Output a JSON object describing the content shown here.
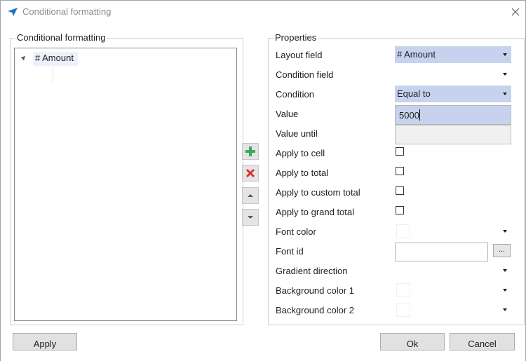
{
  "window": {
    "title": "Conditional formatting",
    "accent_color": "#1a73c8"
  },
  "left_panel": {
    "legend": "Conditional formatting",
    "tree_items": [
      {
        "label": "# Amount",
        "selected": true
      }
    ]
  },
  "side_buttons": {
    "add_icon": "plus-icon",
    "delete_icon": "delete-x-icon",
    "up_icon": "move-up-icon",
    "down_icon": "move-down-icon",
    "add_color": "#3bab5a",
    "delete_color": "#d9342b"
  },
  "properties": {
    "legend": "Properties",
    "layout_field": {
      "label": "Layout field",
      "value": "# Amount"
    },
    "condition_field": {
      "label": "Condition field",
      "value": ""
    },
    "condition": {
      "label": "Condition",
      "value": "Equal to"
    },
    "value": {
      "label": "Value",
      "value": "5000"
    },
    "value_until": {
      "label": "Value until",
      "value": ""
    },
    "apply_to_cell": {
      "label": "Apply to cell",
      "checked": false
    },
    "apply_to_total": {
      "label": "Apply to total",
      "checked": false
    },
    "apply_to_custom_total": {
      "label": "Apply to custom total",
      "checked": false
    },
    "apply_to_grand_total": {
      "label": "Apply to grand total",
      "checked": false
    },
    "font_color": {
      "label": "Font color",
      "value": ""
    },
    "font_id": {
      "label": "Font id",
      "value": "",
      "browse_label": "..."
    },
    "gradient_direction": {
      "label": "Gradient direction",
      "value": ""
    },
    "background_color_1": {
      "label": "Background color 1",
      "value": ""
    },
    "background_color_2": {
      "label": "Background color 2",
      "value": ""
    }
  },
  "footer": {
    "apply_label": "Apply",
    "ok_label": "Ok",
    "cancel_label": "Cancel"
  }
}
